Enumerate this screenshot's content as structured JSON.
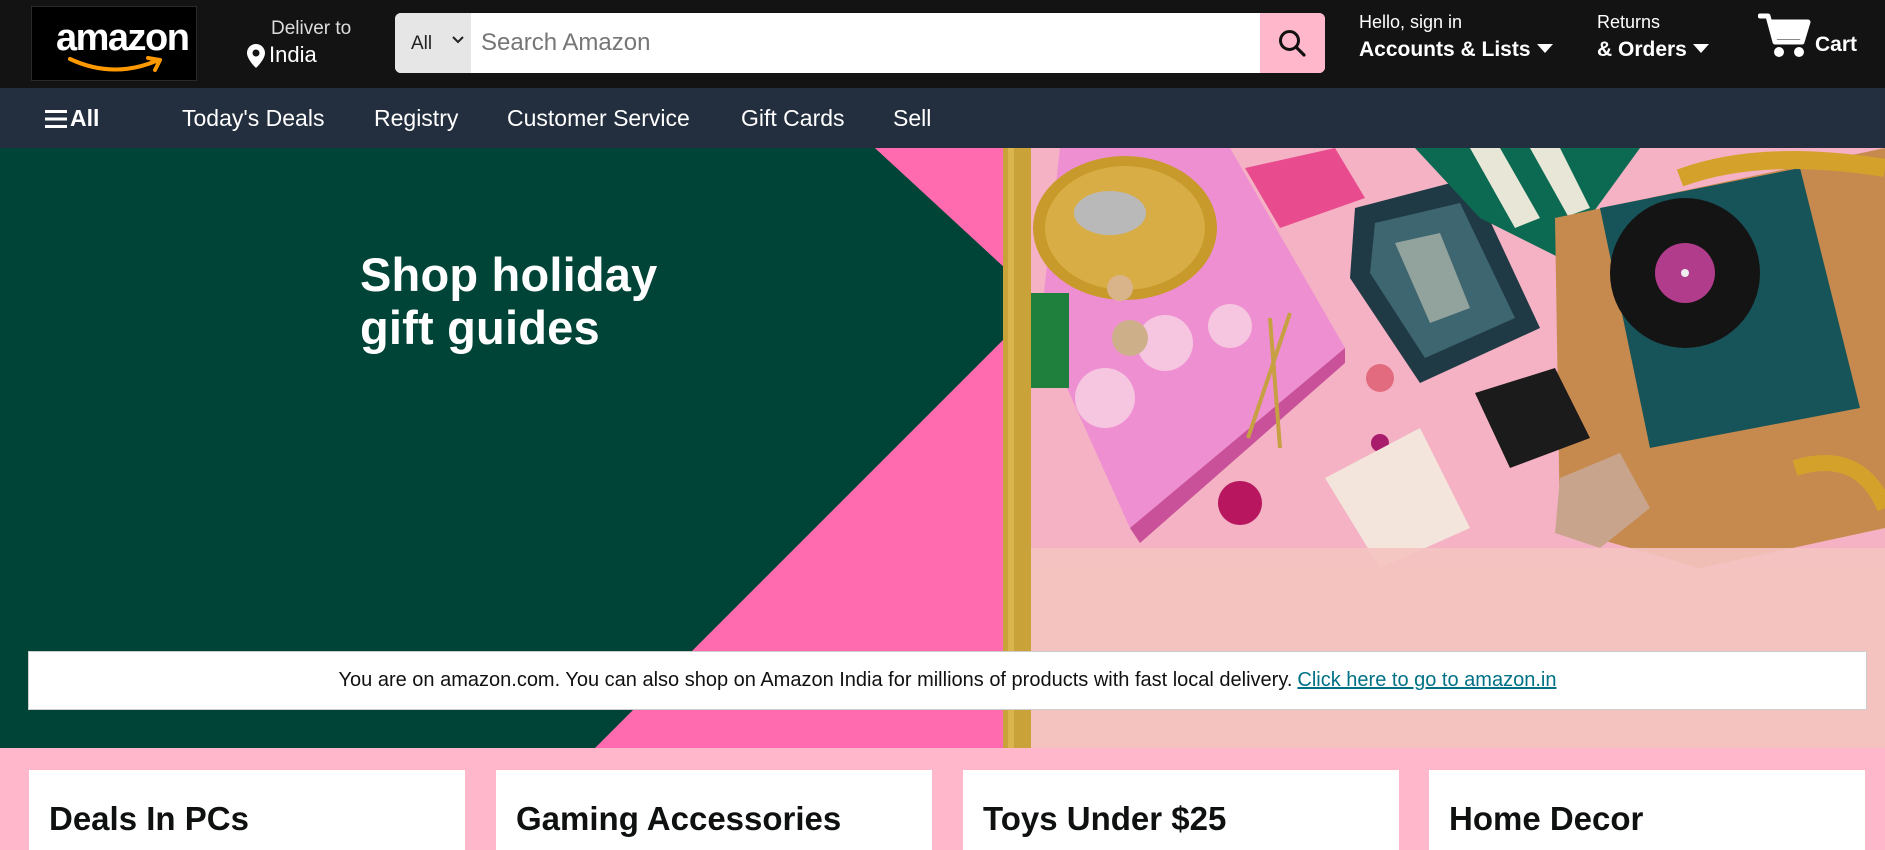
{
  "header": {
    "logo_text": "amazon",
    "deliver_line1": "Deliver to",
    "deliver_line2": "India",
    "search": {
      "category": "All",
      "placeholder": "Search Amazon"
    },
    "account_line1": "Hello, sign in",
    "account_line2": "Accounts & Lists",
    "returns_line1": "Returns",
    "returns_line2": "& Orders",
    "cart_label": "Cart"
  },
  "subnav": {
    "all_label": "All",
    "items": [
      "Today's Deals",
      "Registry",
      "Customer Service",
      "Gift Cards",
      "Sell"
    ]
  },
  "hero": {
    "title_line1": "Shop holiday",
    "title_line2": "gift guides"
  },
  "notice": {
    "message": "You are on amazon.com. You can also shop on Amazon India for millions of products with fast local delivery.",
    "link_text": "Click here to go to amazon.in"
  },
  "cards": [
    {
      "title": "Deals In PCs"
    },
    {
      "title": "Gaming Accessories"
    },
    {
      "title": "Toys Under $25"
    },
    {
      "title": "Home Decor"
    }
  ],
  "colors": {
    "topbar": "#131313",
    "subnav": "#232f3e",
    "accent_pink": "#ffb8cb",
    "hero_green": "#004437",
    "hero_pink": "#ff6bae",
    "link": "#007185"
  }
}
